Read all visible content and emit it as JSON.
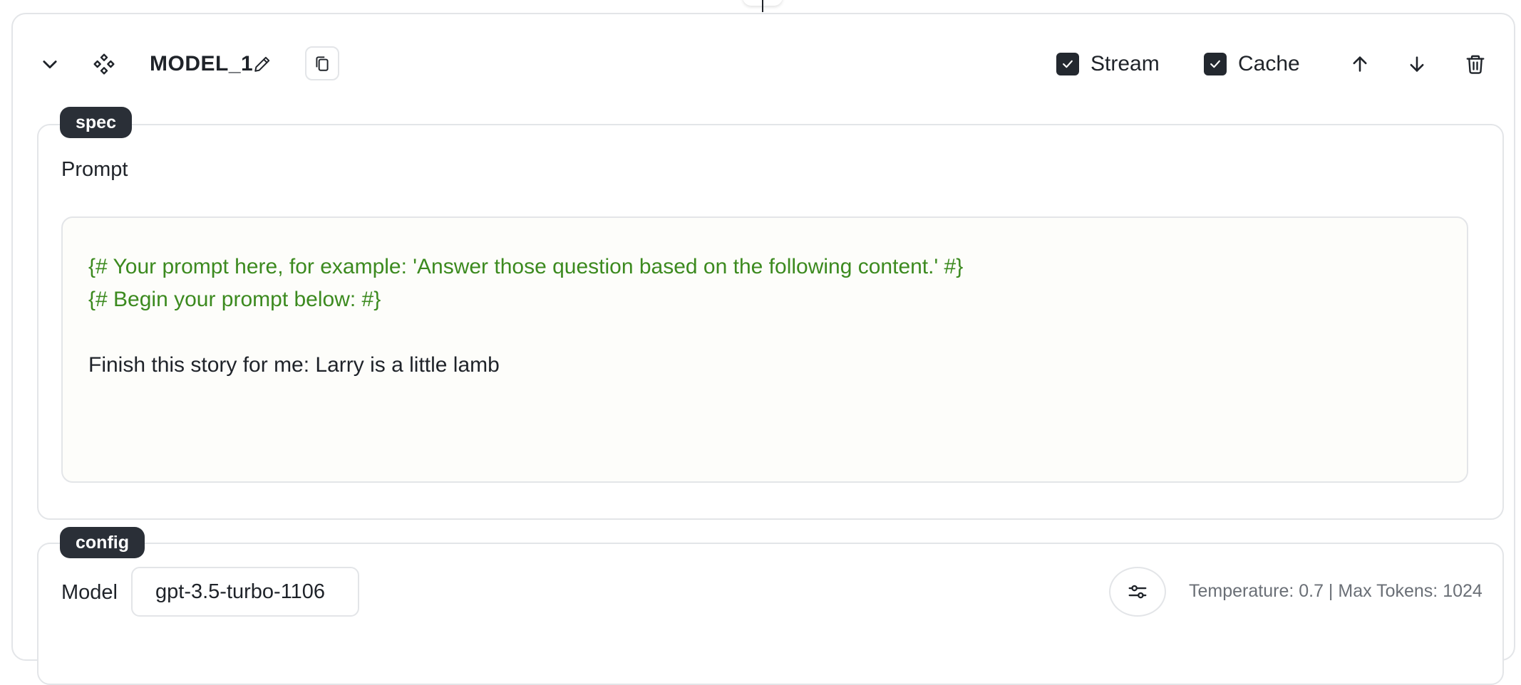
{
  "node": {
    "title": "MODEL_1",
    "icons": {
      "collapse": "chevron-down-icon",
      "node_type": "diamond-grid-icon",
      "edit": "pencil-icon",
      "copy": "copy-icon",
      "move_up": "arrow-up-icon",
      "move_down": "arrow-down-icon",
      "delete": "trash-icon"
    },
    "stream": {
      "label": "Stream",
      "checked": true
    },
    "cache": {
      "label": "Cache",
      "checked": true
    }
  },
  "spec": {
    "tag": "spec",
    "prompt_label": "Prompt",
    "prompt_lines": [
      {
        "kind": "comment",
        "text": "{# Your prompt here, for example: 'Answer those question based on the following content.' #}"
      },
      {
        "kind": "comment",
        "text": "{# Begin your prompt below: #}"
      },
      {
        "kind": "text",
        "text": ""
      },
      {
        "kind": "text",
        "text": "Finish this story for me: Larry is a little lamb"
      }
    ]
  },
  "config": {
    "tag": "config",
    "model_label": "Model",
    "model_value": "gpt-3.5-turbo-1106",
    "settings_icon": "sliders-icon",
    "summary": "Temperature: 0.7 | Max Tokens: 1024"
  },
  "colors": {
    "comment_text": "#3c8a1f",
    "tag_bg": "#2a2f37",
    "checkbox_bg": "#23282f",
    "border": "#e3e5e8"
  }
}
